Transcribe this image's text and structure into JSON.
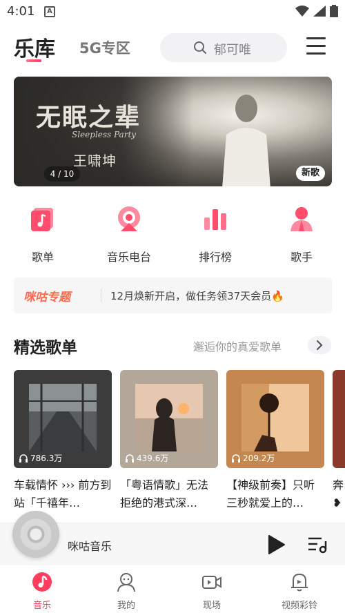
{
  "status_bar": {
    "time": "4:01",
    "notification_icon": "A"
  },
  "header": {
    "tab_active": "乐库",
    "tab_other": "5G专区",
    "search_placeholder": "郁可唯"
  },
  "banner": {
    "title": "无眠之辈",
    "subtitle": "Sleepless Party",
    "artist": "王啸坤",
    "pager": "4 / 10",
    "badge": "新歌"
  },
  "quick_nav": [
    {
      "label": "歌单",
      "icon": "playlist-icon"
    },
    {
      "label": "音乐电台",
      "icon": "radio-icon"
    },
    {
      "label": "排行榜",
      "icon": "chart-icon"
    },
    {
      "label": "歌手",
      "icon": "singer-icon"
    }
  ],
  "promo": {
    "tag": "咪咕专题",
    "text": "12月焕新开启，做任务领37天会员🔥"
  },
  "section": {
    "title": "精选歌单",
    "more": "邂逅你的真爱歌单"
  },
  "playlists": [
    {
      "plays": "786.3万",
      "name": "车载情怀 ››› 前方到站「千禧年…"
    },
    {
      "plays": "439.6万",
      "name": "「粤语情歌」无法拒绝的港式深…"
    },
    {
      "plays": "209.2万",
      "name": "【神级前奏】只听三秒就爱上的…"
    },
    {
      "plays": "",
      "name": "奔 ❥"
    }
  ],
  "player": {
    "title": "咪咕音乐"
  },
  "tabbar": [
    {
      "label": "音乐",
      "icon": "music-note-icon",
      "active": true
    },
    {
      "label": "我的",
      "icon": "user-icon",
      "active": false
    },
    {
      "label": "现场",
      "icon": "video-camera-icon",
      "active": false
    },
    {
      "label": "视频彩铃",
      "icon": "ringtone-bell-icon",
      "active": false
    }
  ],
  "colors": {
    "accent": "#ff3d5e",
    "accent_light": "#ff7a95"
  }
}
